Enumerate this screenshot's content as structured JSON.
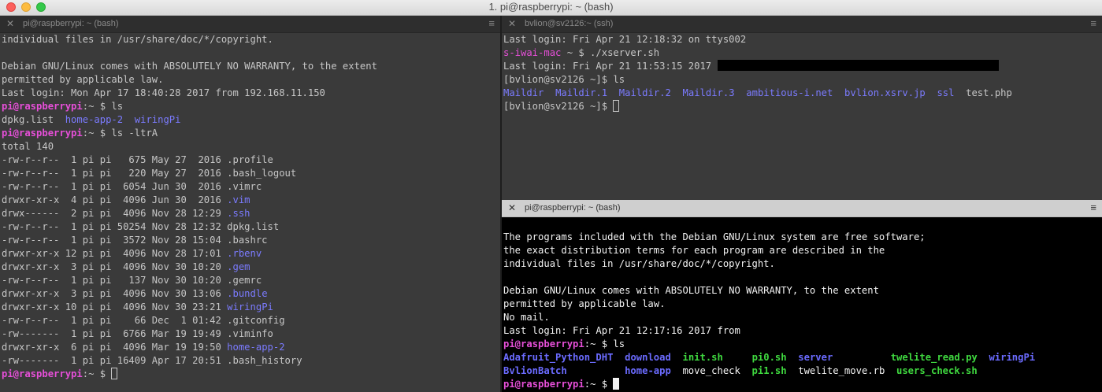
{
  "window": {
    "title": "1. pi@raspberrypi: ~ (bash)"
  },
  "left_pane": {
    "tab_title": "pi@raspberrypi: ~ (bash)",
    "lines": [
      [
        {
          "t": "individual files in /usr/share/doc/*/copyright."
        }
      ],
      [
        {
          "t": ""
        }
      ],
      [
        {
          "t": "Debian GNU/Linux comes with ABSOLUTELY NO WARRANTY, to the extent"
        }
      ],
      [
        {
          "t": "permitted by applicable law."
        }
      ],
      [
        {
          "t": "Last login: Mon Apr 17 18:40:28 2017 from 192.168.11.150"
        }
      ],
      [
        {
          "t": "pi@raspberrypi",
          "c": "pr"
        },
        {
          "t": ":~ $ ls"
        }
      ],
      [
        {
          "t": "dpkg.list  "
        },
        {
          "t": "home-app-2",
          "c": "dir"
        },
        {
          "t": "  "
        },
        {
          "t": "wiringPi",
          "c": "dir"
        }
      ],
      [
        {
          "t": "pi@raspberrypi",
          "c": "pr"
        },
        {
          "t": ":~ $ ls -ltrA"
        }
      ],
      [
        {
          "t": "total 140"
        }
      ],
      [
        {
          "t": "-rw-r--r--  1 pi pi   675 May 27  2016 .profile"
        }
      ],
      [
        {
          "t": "-rw-r--r--  1 pi pi   220 May 27  2016 .bash_logout"
        }
      ],
      [
        {
          "t": "-rw-r--r--  1 pi pi  6054 Jun 30  2016 .vimrc"
        }
      ],
      [
        {
          "t": "drwxr-xr-x  4 pi pi  4096 Jun 30  2016 "
        },
        {
          "t": ".vim",
          "c": "dir"
        }
      ],
      [
        {
          "t": "drwx------  2 pi pi  4096 Nov 28 12:29 "
        },
        {
          "t": ".ssh",
          "c": "dir"
        }
      ],
      [
        {
          "t": "-rw-r--r--  1 pi pi 50254 Nov 28 12:32 dpkg.list"
        }
      ],
      [
        {
          "t": "-rw-r--r--  1 pi pi  3572 Nov 28 15:04 .bashrc"
        }
      ],
      [
        {
          "t": "drwxr-xr-x 12 pi pi  4096 Nov 28 17:01 "
        },
        {
          "t": ".rbenv",
          "c": "dir"
        }
      ],
      [
        {
          "t": "drwxr-xr-x  3 pi pi  4096 Nov 30 10:20 "
        },
        {
          "t": ".gem",
          "c": "dir"
        }
      ],
      [
        {
          "t": "-rw-r--r--  1 pi pi   137 Nov 30 10:20 .gemrc"
        }
      ],
      [
        {
          "t": "drwxr-xr-x  3 pi pi  4096 Nov 30 13:06 "
        },
        {
          "t": ".bundle",
          "c": "dir"
        }
      ],
      [
        {
          "t": "drwxr-xr-x 10 pi pi  4096 Nov 30 23:21 "
        },
        {
          "t": "wiringPi",
          "c": "dir"
        }
      ],
      [
        {
          "t": "-rw-r--r--  1 pi pi    66 Dec  1 01:42 .gitconfig"
        }
      ],
      [
        {
          "t": "-rw-------  1 pi pi  6766 Mar 19 19:49 .viminfo"
        }
      ],
      [
        {
          "t": "drwxr-xr-x  6 pi pi  4096 Mar 19 19:50 "
        },
        {
          "t": "home-app-2",
          "c": "dir"
        }
      ],
      [
        {
          "t": "-rw-------  1 pi pi 16409 Apr 17 20:51 .bash_history"
        }
      ],
      [
        {
          "t": "pi@raspberrypi",
          "c": "pr"
        },
        {
          "t": ":~ $ "
        },
        {
          "cursor": true
        }
      ]
    ]
  },
  "top_right_pane": {
    "tab_title": "bvlion@sv2126:~ (ssh)",
    "lines": [
      [
        {
          "t": "Last login: Fri Apr 21 12:18:32 on ttys002"
        }
      ],
      [
        {
          "t": "s-iwai-mac",
          "c": "pr2"
        },
        {
          "t": " ~ $ ./xserver.sh"
        }
      ],
      [
        {
          "t": "Last login: Fri Apr 21 11:53:15 2017 "
        },
        {
          "redact": true
        }
      ],
      [
        {
          "t": "[bvlion@sv2126 ~]$ ls"
        }
      ],
      [
        {
          "t": "Maildir",
          "c": "dir"
        },
        {
          "t": "  "
        },
        {
          "t": "Maildir.1",
          "c": "dir"
        },
        {
          "t": "  "
        },
        {
          "t": "Maildir.2",
          "c": "dir"
        },
        {
          "t": "  "
        },
        {
          "t": "Maildir.3",
          "c": "dir"
        },
        {
          "t": "  "
        },
        {
          "t": "ambitious-i.net",
          "c": "dir"
        },
        {
          "t": "  "
        },
        {
          "t": "bvlion.xsrv.jp",
          "c": "dir"
        },
        {
          "t": "  "
        },
        {
          "t": "ssl",
          "c": "dir"
        },
        {
          "t": "  test.php"
        }
      ],
      [
        {
          "t": "[bvlion@sv2126 ~]$ "
        },
        {
          "cursor": true
        }
      ]
    ]
  },
  "bottom_right_pane": {
    "tab_title": "pi@raspberrypi: ~ (bash)",
    "lines": [
      [
        {
          "t": ""
        }
      ],
      [
        {
          "t": "The programs included with the Debian GNU/Linux system are free software;"
        }
      ],
      [
        {
          "t": "the exact distribution terms for each program are described in the"
        }
      ],
      [
        {
          "t": "individual files in /usr/share/doc/*/copyright."
        }
      ],
      [
        {
          "t": ""
        }
      ],
      [
        {
          "t": "Debian GNU/Linux comes with ABSOLUTELY NO WARRANTY, to the extent"
        }
      ],
      [
        {
          "t": "permitted by applicable law."
        }
      ],
      [
        {
          "t": "No mail."
        }
      ],
      [
        {
          "t": "Last login: Fri Apr 21 12:17:16 2017 from"
        }
      ],
      [
        {
          "t": "pi@raspberrypi",
          "c": "pr"
        },
        {
          "t": ":~ $ ls"
        }
      ],
      [
        {
          "t": "Adafruit_Python_DHT",
          "c": "dirb"
        },
        {
          "t": "  "
        },
        {
          "t": "download",
          "c": "dirb"
        },
        {
          "t": "  "
        },
        {
          "t": "init.sh",
          "c": "exe"
        },
        {
          "t": "     "
        },
        {
          "t": "pi0.sh",
          "c": "exe"
        },
        {
          "t": "  "
        },
        {
          "t": "server",
          "c": "dirb"
        },
        {
          "t": "          "
        },
        {
          "t": "twelite_read.py",
          "c": "exe"
        },
        {
          "t": "  "
        },
        {
          "t": "wiringPi",
          "c": "dirb"
        }
      ],
      [
        {
          "t": "BvlionBatch",
          "c": "dirb"
        },
        {
          "t": "          "
        },
        {
          "t": "home-app",
          "c": "dirb"
        },
        {
          "t": "  move_check  "
        },
        {
          "t": "pi1.sh",
          "c": "exe"
        },
        {
          "t": "  twelite_move.rb  "
        },
        {
          "t": "users_check.sh",
          "c": "exe"
        }
      ],
      [
        {
          "t": "pi@raspberrypi",
          "c": "pr"
        },
        {
          "t": ":~ $ "
        },
        {
          "cursor": true
        }
      ]
    ]
  },
  "icons": {
    "close": "close-icon",
    "menu": "hamburger-menu-icon"
  },
  "colors": {
    "prompt": "#e64fd8",
    "directory": "#7b7bff",
    "executable": "#3fd83f",
    "active_bg": "#000000",
    "inactive_bg": "#3a3a3a"
  }
}
